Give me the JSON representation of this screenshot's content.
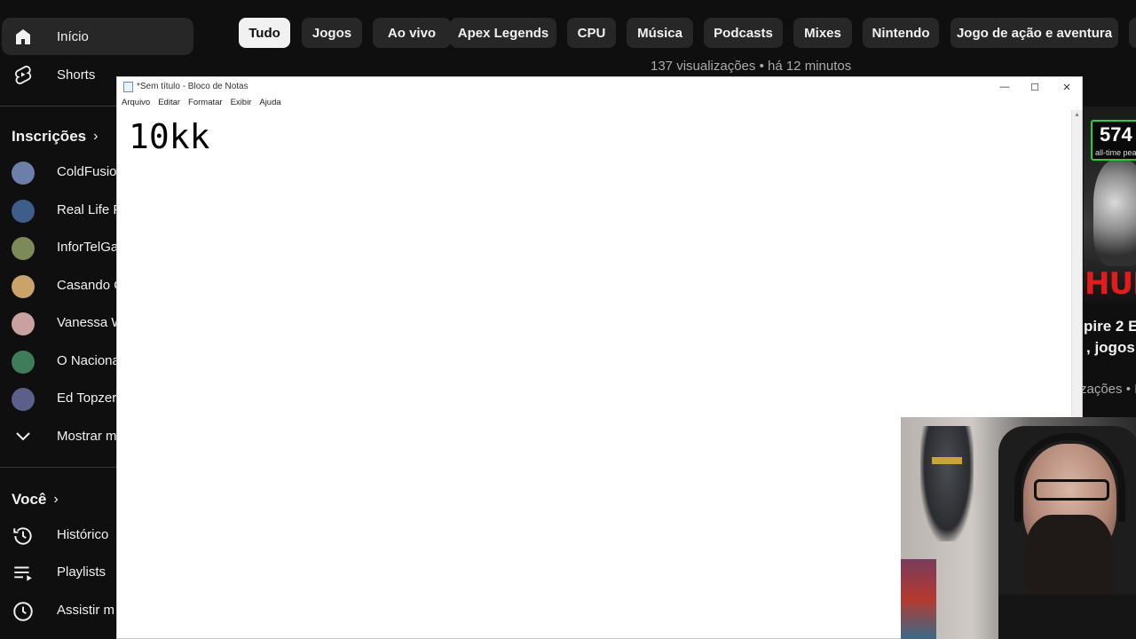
{
  "sidebar": {
    "home_label": "Início",
    "shorts_label": "Shorts",
    "subscriptions_title": "Inscrições",
    "subscriptions": [
      {
        "label": "ColdFusio",
        "color": "#6b7fa8"
      },
      {
        "label": "Real Life F",
        "color": "#3f5d8a"
      },
      {
        "label": "InforTelGa",
        "color": "#7c8a5a"
      },
      {
        "label": "Casando C",
        "color": "#c9a36a"
      },
      {
        "label": "Vanessa W",
        "color": "#c9a2a0"
      },
      {
        "label": "O Naciona",
        "color": "#3f7d5a"
      },
      {
        "label": "Ed Topzer",
        "color": "#5b5f8a"
      }
    ],
    "show_more_label": "Mostrar m",
    "you_title": "Você",
    "history_label": "Histórico",
    "playlists_label": "Playlists",
    "watch_later_label": "Assistir m"
  },
  "chips": [
    "Tudo",
    "Jogos",
    "Ao vivo",
    "Apex Legends",
    "CPU",
    "Música",
    "Podcasts",
    "Mixes",
    "Nintendo",
    "Jogo de ação e aventura"
  ],
  "video_meta": "137 visualizações • há 12 minutos",
  "right_card": {
    "peak_number": "574",
    "peak_caption": "all-time pea",
    "thumb_text": "HUM",
    "title_line1": "pire 2 E",
    "title_line2": ", jogos A",
    "meta": "zações • I"
  },
  "notepad": {
    "title": "*Sem título - Bloco de Notas",
    "menus": [
      "Arquivo",
      "Editar",
      "Formatar",
      "Exibir",
      "Ajuda"
    ],
    "content": "10kk",
    "controls": {
      "minimize": "—",
      "maximize": "☐",
      "close": "✕"
    }
  }
}
